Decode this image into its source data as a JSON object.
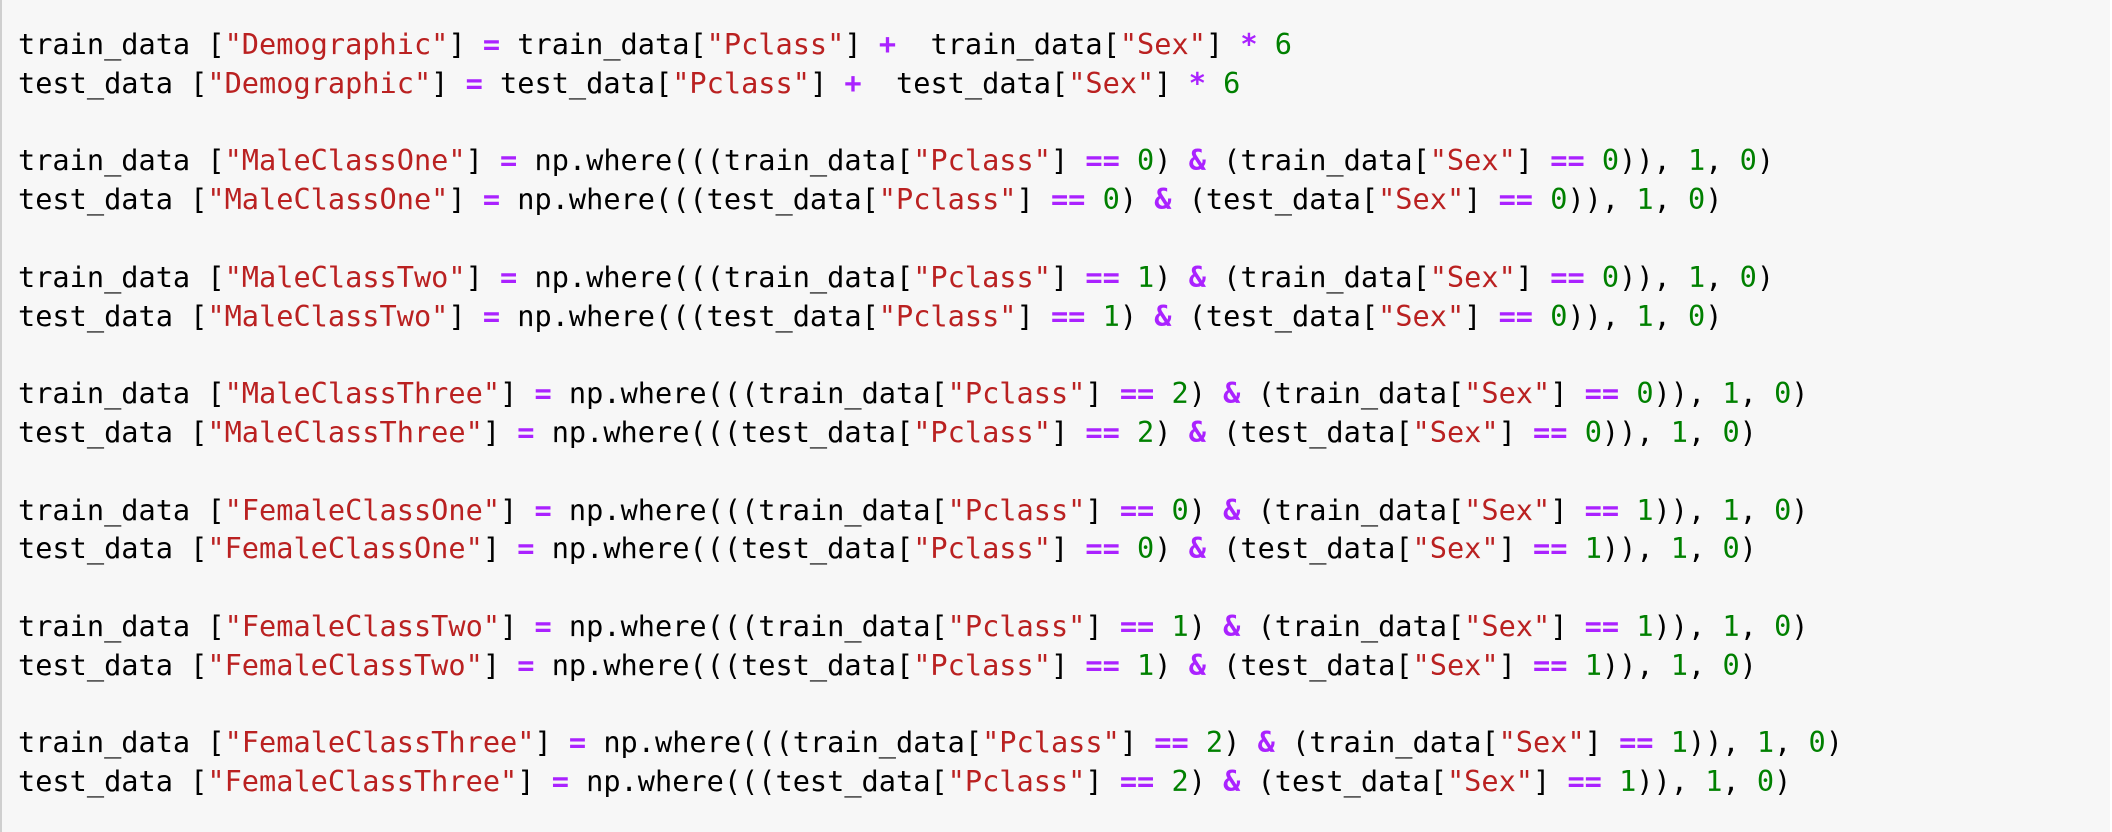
{
  "cell": {
    "type": "code",
    "lines": [
      [
        [
          "id",
          "train_data ["
        ],
        [
          "str",
          "\"Demographic\""
        ],
        [
          "id",
          "] "
        ],
        [
          "op",
          "="
        ],
        [
          "id",
          " train_data["
        ],
        [
          "str",
          "\"Pclass\""
        ],
        [
          "id",
          "] "
        ],
        [
          "op",
          "+"
        ],
        [
          "id",
          "  train_data["
        ],
        [
          "str",
          "\"Sex\""
        ],
        [
          "id",
          "] "
        ],
        [
          "op",
          "*"
        ],
        [
          "id",
          " "
        ],
        [
          "num",
          "6"
        ]
      ],
      [
        [
          "id",
          "test_data ["
        ],
        [
          "str",
          "\"Demographic\""
        ],
        [
          "id",
          "] "
        ],
        [
          "op",
          "="
        ],
        [
          "id",
          " test_data["
        ],
        [
          "str",
          "\"Pclass\""
        ],
        [
          "id",
          "] "
        ],
        [
          "op",
          "+"
        ],
        [
          "id",
          "  test_data["
        ],
        [
          "str",
          "\"Sex\""
        ],
        [
          "id",
          "] "
        ],
        [
          "op",
          "*"
        ],
        [
          "id",
          " "
        ],
        [
          "num",
          "6"
        ]
      ],
      [],
      [
        [
          "id",
          "train_data ["
        ],
        [
          "str",
          "\"MaleClassOne\""
        ],
        [
          "id",
          "] "
        ],
        [
          "op",
          "="
        ],
        [
          "id",
          " np.where(((train_data["
        ],
        [
          "str",
          "\"Pclass\""
        ],
        [
          "id",
          "] "
        ],
        [
          "op",
          "=="
        ],
        [
          "id",
          " "
        ],
        [
          "num",
          "0"
        ],
        [
          "id",
          ") "
        ],
        [
          "op",
          "&"
        ],
        [
          "id",
          " (train_data["
        ],
        [
          "str",
          "\"Sex\""
        ],
        [
          "id",
          "] "
        ],
        [
          "op",
          "=="
        ],
        [
          "id",
          " "
        ],
        [
          "num",
          "0"
        ],
        [
          "id",
          ")), "
        ],
        [
          "num",
          "1"
        ],
        [
          "id",
          ", "
        ],
        [
          "num",
          "0"
        ],
        [
          "id",
          ")"
        ]
      ],
      [
        [
          "id",
          "test_data ["
        ],
        [
          "str",
          "\"MaleClassOne\""
        ],
        [
          "id",
          "] "
        ],
        [
          "op",
          "="
        ],
        [
          "id",
          " np.where(((test_data["
        ],
        [
          "str",
          "\"Pclass\""
        ],
        [
          "id",
          "] "
        ],
        [
          "op",
          "=="
        ],
        [
          "id",
          " "
        ],
        [
          "num",
          "0"
        ],
        [
          "id",
          ") "
        ],
        [
          "op",
          "&"
        ],
        [
          "id",
          " (test_data["
        ],
        [
          "str",
          "\"Sex\""
        ],
        [
          "id",
          "] "
        ],
        [
          "op",
          "=="
        ],
        [
          "id",
          " "
        ],
        [
          "num",
          "0"
        ],
        [
          "id",
          ")), "
        ],
        [
          "num",
          "1"
        ],
        [
          "id",
          ", "
        ],
        [
          "num",
          "0"
        ],
        [
          "id",
          ")"
        ]
      ],
      [],
      [
        [
          "id",
          "train_data ["
        ],
        [
          "str",
          "\"MaleClassTwo\""
        ],
        [
          "id",
          "] "
        ],
        [
          "op",
          "="
        ],
        [
          "id",
          " np.where(((train_data["
        ],
        [
          "str",
          "\"Pclass\""
        ],
        [
          "id",
          "] "
        ],
        [
          "op",
          "=="
        ],
        [
          "id",
          " "
        ],
        [
          "num",
          "1"
        ],
        [
          "id",
          ") "
        ],
        [
          "op",
          "&"
        ],
        [
          "id",
          " (train_data["
        ],
        [
          "str",
          "\"Sex\""
        ],
        [
          "id",
          "] "
        ],
        [
          "op",
          "=="
        ],
        [
          "id",
          " "
        ],
        [
          "num",
          "0"
        ],
        [
          "id",
          ")), "
        ],
        [
          "num",
          "1"
        ],
        [
          "id",
          ", "
        ],
        [
          "num",
          "0"
        ],
        [
          "id",
          ")"
        ]
      ],
      [
        [
          "id",
          "test_data ["
        ],
        [
          "str",
          "\"MaleClassTwo\""
        ],
        [
          "id",
          "] "
        ],
        [
          "op",
          "="
        ],
        [
          "id",
          " np.where(((test_data["
        ],
        [
          "str",
          "\"Pclass\""
        ],
        [
          "id",
          "] "
        ],
        [
          "op",
          "=="
        ],
        [
          "id",
          " "
        ],
        [
          "num",
          "1"
        ],
        [
          "id",
          ") "
        ],
        [
          "op",
          "&"
        ],
        [
          "id",
          " (test_data["
        ],
        [
          "str",
          "\"Sex\""
        ],
        [
          "id",
          "] "
        ],
        [
          "op",
          "=="
        ],
        [
          "id",
          " "
        ],
        [
          "num",
          "0"
        ],
        [
          "id",
          ")), "
        ],
        [
          "num",
          "1"
        ],
        [
          "id",
          ", "
        ],
        [
          "num",
          "0"
        ],
        [
          "id",
          ")"
        ]
      ],
      [],
      [
        [
          "id",
          "train_data ["
        ],
        [
          "str",
          "\"MaleClassThree\""
        ],
        [
          "id",
          "] "
        ],
        [
          "op",
          "="
        ],
        [
          "id",
          " np.where(((train_data["
        ],
        [
          "str",
          "\"Pclass\""
        ],
        [
          "id",
          "] "
        ],
        [
          "op",
          "=="
        ],
        [
          "id",
          " "
        ],
        [
          "num",
          "2"
        ],
        [
          "id",
          ") "
        ],
        [
          "op",
          "&"
        ],
        [
          "id",
          " (train_data["
        ],
        [
          "str",
          "\"Sex\""
        ],
        [
          "id",
          "] "
        ],
        [
          "op",
          "=="
        ],
        [
          "id",
          " "
        ],
        [
          "num",
          "0"
        ],
        [
          "id",
          ")), "
        ],
        [
          "num",
          "1"
        ],
        [
          "id",
          ", "
        ],
        [
          "num",
          "0"
        ],
        [
          "id",
          ")"
        ]
      ],
      [
        [
          "id",
          "test_data ["
        ],
        [
          "str",
          "\"MaleClassThree\""
        ],
        [
          "id",
          "] "
        ],
        [
          "op",
          "="
        ],
        [
          "id",
          " np.where(((test_data["
        ],
        [
          "str",
          "\"Pclass\""
        ],
        [
          "id",
          "] "
        ],
        [
          "op",
          "=="
        ],
        [
          "id",
          " "
        ],
        [
          "num",
          "2"
        ],
        [
          "id",
          ") "
        ],
        [
          "op",
          "&"
        ],
        [
          "id",
          " (test_data["
        ],
        [
          "str",
          "\"Sex\""
        ],
        [
          "id",
          "] "
        ],
        [
          "op",
          "=="
        ],
        [
          "id",
          " "
        ],
        [
          "num",
          "0"
        ],
        [
          "id",
          ")), "
        ],
        [
          "num",
          "1"
        ],
        [
          "id",
          ", "
        ],
        [
          "num",
          "0"
        ],
        [
          "id",
          ")"
        ]
      ],
      [],
      [
        [
          "id",
          "train_data ["
        ],
        [
          "str",
          "\"FemaleClassOne\""
        ],
        [
          "id",
          "] "
        ],
        [
          "op",
          "="
        ],
        [
          "id",
          " np.where(((train_data["
        ],
        [
          "str",
          "\"Pclass\""
        ],
        [
          "id",
          "] "
        ],
        [
          "op",
          "=="
        ],
        [
          "id",
          " "
        ],
        [
          "num",
          "0"
        ],
        [
          "id",
          ") "
        ],
        [
          "op",
          "&"
        ],
        [
          "id",
          " (train_data["
        ],
        [
          "str",
          "\"Sex\""
        ],
        [
          "id",
          "] "
        ],
        [
          "op",
          "=="
        ],
        [
          "id",
          " "
        ],
        [
          "num",
          "1"
        ],
        [
          "id",
          ")), "
        ],
        [
          "num",
          "1"
        ],
        [
          "id",
          ", "
        ],
        [
          "num",
          "0"
        ],
        [
          "id",
          ")"
        ]
      ],
      [
        [
          "id",
          "test_data ["
        ],
        [
          "str",
          "\"FemaleClassOne\""
        ],
        [
          "id",
          "] "
        ],
        [
          "op",
          "="
        ],
        [
          "id",
          " np.where(((test_data["
        ],
        [
          "str",
          "\"Pclass\""
        ],
        [
          "id",
          "] "
        ],
        [
          "op",
          "=="
        ],
        [
          "id",
          " "
        ],
        [
          "num",
          "0"
        ],
        [
          "id",
          ") "
        ],
        [
          "op",
          "&"
        ],
        [
          "id",
          " (test_data["
        ],
        [
          "str",
          "\"Sex\""
        ],
        [
          "id",
          "] "
        ],
        [
          "op",
          "=="
        ],
        [
          "id",
          " "
        ],
        [
          "num",
          "1"
        ],
        [
          "id",
          ")), "
        ],
        [
          "num",
          "1"
        ],
        [
          "id",
          ", "
        ],
        [
          "num",
          "0"
        ],
        [
          "id",
          ")"
        ]
      ],
      [],
      [
        [
          "id",
          "train_data ["
        ],
        [
          "str",
          "\"FemaleClassTwo\""
        ],
        [
          "id",
          "] "
        ],
        [
          "op",
          "="
        ],
        [
          "id",
          " np.where(((train_data["
        ],
        [
          "str",
          "\"Pclass\""
        ],
        [
          "id",
          "] "
        ],
        [
          "op",
          "=="
        ],
        [
          "id",
          " "
        ],
        [
          "num",
          "1"
        ],
        [
          "id",
          ") "
        ],
        [
          "op",
          "&"
        ],
        [
          "id",
          " (train_data["
        ],
        [
          "str",
          "\"Sex\""
        ],
        [
          "id",
          "] "
        ],
        [
          "op",
          "=="
        ],
        [
          "id",
          " "
        ],
        [
          "num",
          "1"
        ],
        [
          "id",
          ")), "
        ],
        [
          "num",
          "1"
        ],
        [
          "id",
          ", "
        ],
        [
          "num",
          "0"
        ],
        [
          "id",
          ")"
        ]
      ],
      [
        [
          "id",
          "test_data ["
        ],
        [
          "str",
          "\"FemaleClassTwo\""
        ],
        [
          "id",
          "] "
        ],
        [
          "op",
          "="
        ],
        [
          "id",
          " np.where(((test_data["
        ],
        [
          "str",
          "\"Pclass\""
        ],
        [
          "id",
          "] "
        ],
        [
          "op",
          "=="
        ],
        [
          "id",
          " "
        ],
        [
          "num",
          "1"
        ],
        [
          "id",
          ") "
        ],
        [
          "op",
          "&"
        ],
        [
          "id",
          " (test_data["
        ],
        [
          "str",
          "\"Sex\""
        ],
        [
          "id",
          "] "
        ],
        [
          "op",
          "=="
        ],
        [
          "id",
          " "
        ],
        [
          "num",
          "1"
        ],
        [
          "id",
          ")), "
        ],
        [
          "num",
          "1"
        ],
        [
          "id",
          ", "
        ],
        [
          "num",
          "0"
        ],
        [
          "id",
          ")"
        ]
      ],
      [],
      [
        [
          "id",
          "train_data ["
        ],
        [
          "str",
          "\"FemaleClassThree\""
        ],
        [
          "id",
          "] "
        ],
        [
          "op",
          "="
        ],
        [
          "id",
          " np.where(((train_data["
        ],
        [
          "str",
          "\"Pclass\""
        ],
        [
          "id",
          "] "
        ],
        [
          "op",
          "=="
        ],
        [
          "id",
          " "
        ],
        [
          "num",
          "2"
        ],
        [
          "id",
          ") "
        ],
        [
          "op",
          "&"
        ],
        [
          "id",
          " (train_data["
        ],
        [
          "str",
          "\"Sex\""
        ],
        [
          "id",
          "] "
        ],
        [
          "op",
          "=="
        ],
        [
          "id",
          " "
        ],
        [
          "num",
          "1"
        ],
        [
          "id",
          ")), "
        ],
        [
          "num",
          "1"
        ],
        [
          "id",
          ", "
        ],
        [
          "num",
          "0"
        ],
        [
          "id",
          ")"
        ]
      ],
      [
        [
          "id",
          "test_data ["
        ],
        [
          "str",
          "\"FemaleClassThree\""
        ],
        [
          "id",
          "] "
        ],
        [
          "op",
          "="
        ],
        [
          "id",
          " np.where(((test_data["
        ],
        [
          "str",
          "\"Pclass\""
        ],
        [
          "id",
          "] "
        ],
        [
          "op",
          "=="
        ],
        [
          "id",
          " "
        ],
        [
          "num",
          "2"
        ],
        [
          "id",
          ") "
        ],
        [
          "op",
          "&"
        ],
        [
          "id",
          " (test_data["
        ],
        [
          "str",
          "\"Sex\""
        ],
        [
          "id",
          "] "
        ],
        [
          "op",
          "=="
        ],
        [
          "id",
          " "
        ],
        [
          "num",
          "1"
        ],
        [
          "id",
          ")), "
        ],
        [
          "num",
          "1"
        ],
        [
          "id",
          ", "
        ],
        [
          "num",
          "0"
        ],
        [
          "id",
          ")"
        ]
      ]
    ]
  },
  "colors": {
    "background": "#f7f7f7",
    "border": "#cfcfcf",
    "string": "#ba2121",
    "operator": "#aa22ff",
    "number": "#008000",
    "text": "#000000"
  }
}
